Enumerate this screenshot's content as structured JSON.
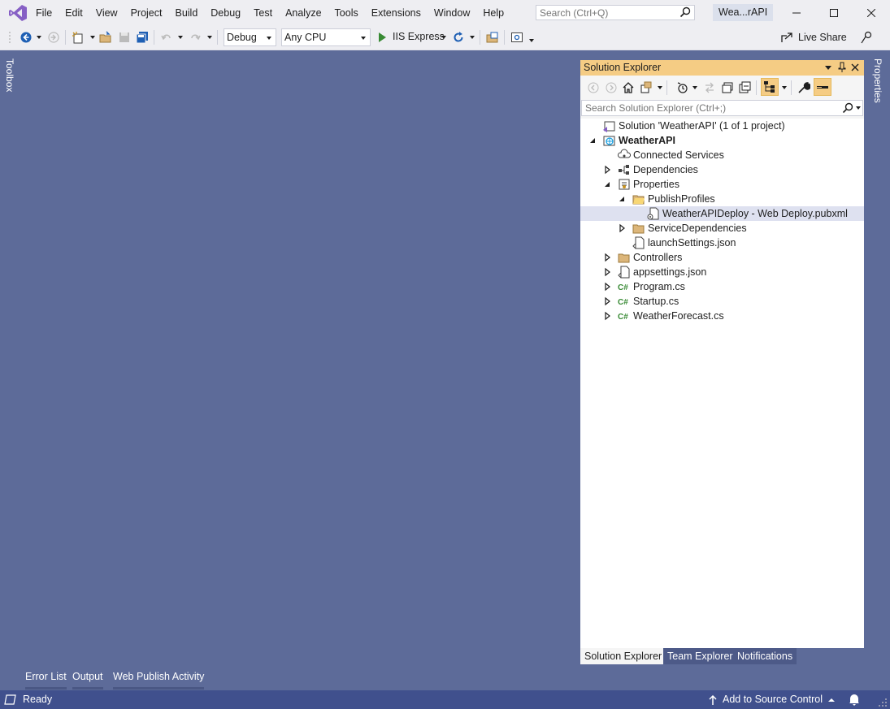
{
  "menu": {
    "items": [
      "File",
      "Edit",
      "View",
      "Project",
      "Build",
      "Debug",
      "Test",
      "Analyze",
      "Tools",
      "Extensions",
      "Window",
      "Help"
    ]
  },
  "search": {
    "placeholder": "Search (Ctrl+Q)"
  },
  "solution_badge": "Wea...rAPI",
  "toolbar": {
    "configuration": "Debug",
    "platform": "Any CPU",
    "run_target": "IIS Express",
    "live_share": "Live Share"
  },
  "side_tabs": {
    "toolbox": "Toolbox",
    "properties": "Properties"
  },
  "solution_explorer": {
    "title": "Solution Explorer",
    "search_placeholder": "Search Solution Explorer (Ctrl+;)",
    "tree": [
      {
        "label": "Solution 'WeatherAPI' (1 of 1 project)",
        "icon": "solution-icon",
        "level": 0,
        "toggle": "none"
      },
      {
        "label": "WeatherAPI",
        "icon": "web-project-icon",
        "level": 0,
        "toggle": "expanded",
        "bold": true
      },
      {
        "label": "Connected Services",
        "icon": "connected-services-icon",
        "level": 1,
        "toggle": "none"
      },
      {
        "label": "Dependencies",
        "icon": "dependencies-icon",
        "level": 1,
        "toggle": "collapsed"
      },
      {
        "label": "Properties",
        "icon": "properties-icon",
        "level": 1,
        "toggle": "expanded"
      },
      {
        "label": "PublishProfiles",
        "icon": "open-folder-icon",
        "level": 2,
        "toggle": "expanded"
      },
      {
        "label": "WeatherAPIDeploy - Web Deploy.pubxml",
        "icon": "publish-file-icon",
        "level": 3,
        "toggle": "none",
        "selected": true
      },
      {
        "label": "ServiceDependencies",
        "icon": "folder-icon",
        "level": 2,
        "toggle": "collapsed"
      },
      {
        "label": "launchSettings.json",
        "icon": "json-file-icon",
        "level": 2,
        "toggle": "none"
      },
      {
        "label": "Controllers",
        "icon": "folder-icon",
        "level": 1,
        "toggle": "collapsed"
      },
      {
        "label": "appsettings.json",
        "icon": "json-file-icon",
        "level": 1,
        "toggle": "collapsed"
      },
      {
        "label": "Program.cs",
        "icon": "csharp-file-icon",
        "level": 1,
        "toggle": "collapsed"
      },
      {
        "label": "Startup.cs",
        "icon": "csharp-file-icon",
        "level": 1,
        "toggle": "collapsed"
      },
      {
        "label": "WeatherForecast.cs",
        "icon": "csharp-file-icon",
        "level": 1,
        "toggle": "collapsed"
      }
    ],
    "tabs": [
      "Solution Explorer",
      "Team Explorer",
      "Notifications"
    ]
  },
  "bottom_tabs": [
    "Error List",
    "Output",
    "Web Publish Activity"
  ],
  "status": {
    "text": "Ready",
    "source_control": "Add to Source Control"
  },
  "colors": {
    "accent": "#f5cc84",
    "background": "#5d6b99",
    "statusbar": "#40508d",
    "selection": "#dee1f0"
  }
}
